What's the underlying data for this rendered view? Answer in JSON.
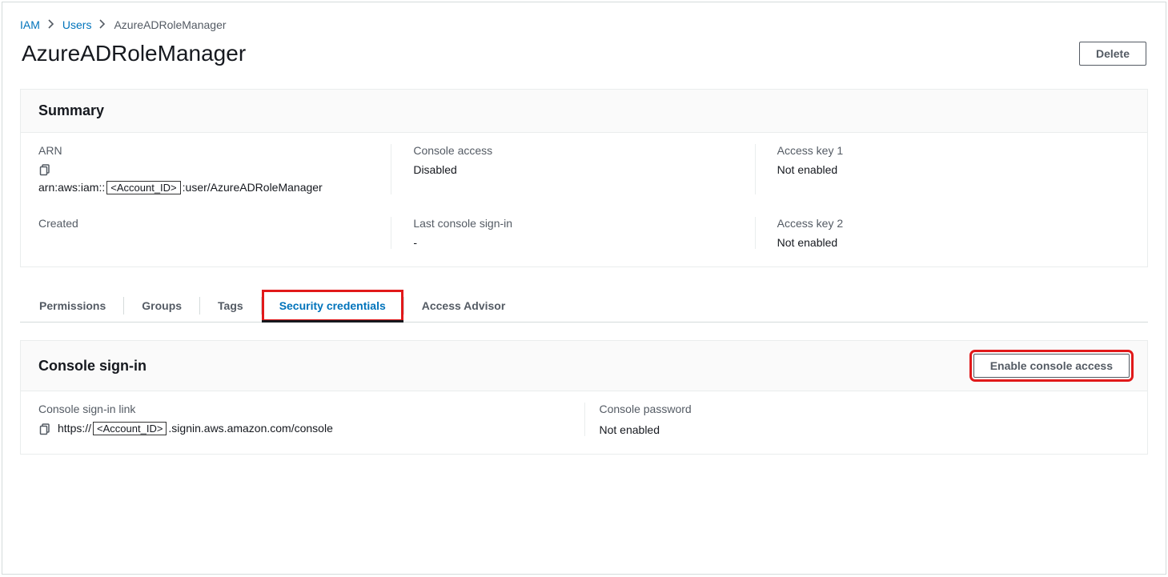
{
  "breadcrumb": {
    "root": "IAM",
    "level1": "Users",
    "current": "AzureADRoleManager"
  },
  "page": {
    "title": "AzureADRoleManager",
    "delete_btn": "Delete"
  },
  "summary": {
    "header": "Summary",
    "arn_label": "ARN",
    "arn_prefix": "arn:aws:iam::",
    "arn_placeholder": "<Account_ID>",
    "arn_suffix": ":user/AzureADRoleManager",
    "console_access_label": "Console access",
    "console_access_value": "Disabled",
    "access_key1_label": "Access key 1",
    "access_key1_value": "Not enabled",
    "created_label": "Created",
    "last_signin_label": "Last console sign-in",
    "last_signin_value": "-",
    "access_key2_label": "Access key 2",
    "access_key2_value": "Not enabled"
  },
  "tabs": {
    "permissions": "Permissions",
    "groups": "Groups",
    "tags": "Tags",
    "security_credentials": "Security credentials",
    "access_advisor": "Access Advisor"
  },
  "console_signin": {
    "header": "Console sign-in",
    "enable_btn": "Enable console access",
    "link_label": "Console sign-in link",
    "link_prefix": "https://",
    "link_placeholder": "<Account_ID>",
    "link_suffix": ".signin.aws.amazon.com/console",
    "password_label": "Console password",
    "password_value": "Not enabled"
  }
}
